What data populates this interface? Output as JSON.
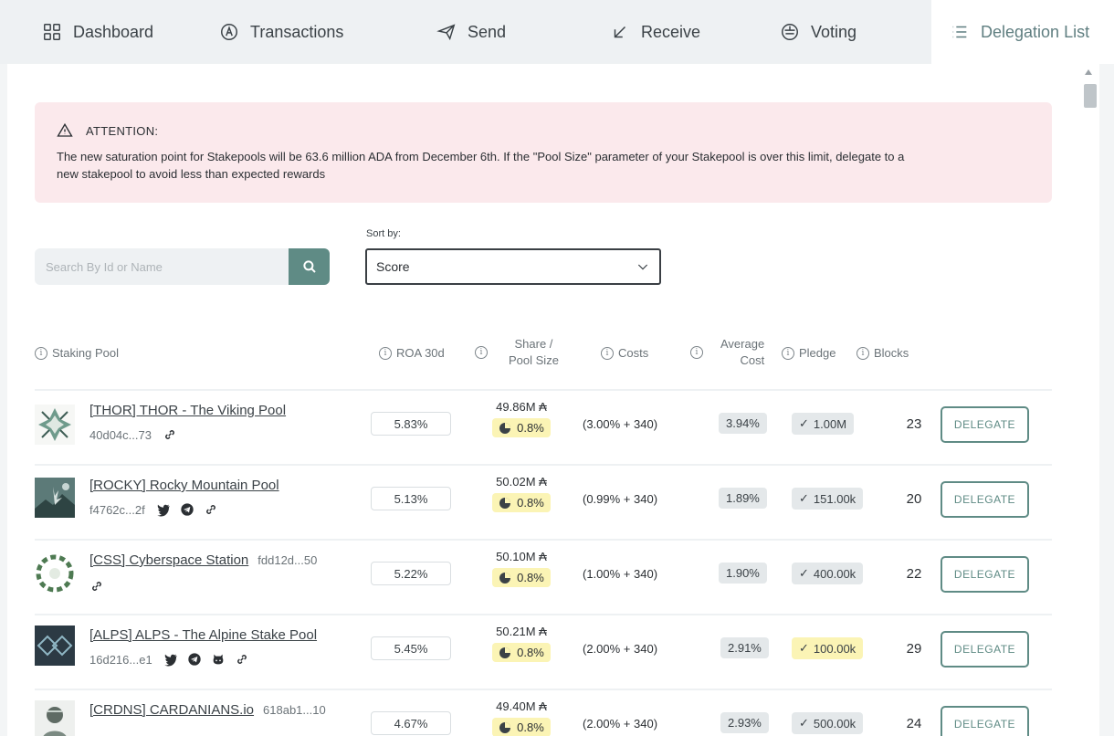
{
  "tabs": [
    {
      "label": "Dashboard",
      "icon": "dashboard-icon"
    },
    {
      "label": "Transactions",
      "icon": "ada-icon"
    },
    {
      "label": "Send",
      "icon": "send-icon"
    },
    {
      "label": "Receive",
      "icon": "receive-arrow-icon"
    },
    {
      "label": "Voting",
      "icon": "voting-icon"
    },
    {
      "label": "Delegation List",
      "icon": "list-icon",
      "active": true
    }
  ],
  "attention": {
    "title": "ATTENTION:",
    "line1": "The new saturation point for Stakepools will be 63.6 million ADA from December 6th. If the \"Pool Size\" parameter of your Stakepool is over this limit, delegate to a",
    "line2": "new stakepool to avoid less than expected rewards"
  },
  "search": {
    "placeholder": "Search By Id or Name"
  },
  "sort": {
    "label": "Sort by:",
    "value": "Score"
  },
  "table": {
    "headers": {
      "pool": "Staking Pool",
      "roa": "ROA 30d",
      "share_1": "Share /",
      "share_2": "Pool Size",
      "costs": "Costs",
      "avg_1": "Average",
      "avg_2": "Cost",
      "pledge": "Pledge",
      "blocks": "Blocks"
    },
    "delegate_label": "DELEGATE",
    "rows": [
      {
        "name": "[THOR] THOR - The Viking Pool",
        "id": "40d04c...73",
        "roa": "5.83%",
        "size": "49.86M ₳",
        "share": "0.8%",
        "costs": "(3.00% + 340)",
        "avg": "3.94%",
        "pledge": "1.00M",
        "blocks": "23"
      },
      {
        "name": "[ROCKY] Rocky Mountain Pool",
        "id": "f4762c...2f",
        "roa": "5.13%",
        "size": "50.02M ₳",
        "share": "0.8%",
        "costs": "(0.99% + 340)",
        "avg": "1.89%",
        "pledge": "151.00k",
        "blocks": "20"
      },
      {
        "name": "[CSS] Cyberspace Station",
        "id": "fdd12d...50",
        "roa": "5.22%",
        "size": "50.10M ₳",
        "share": "0.8%",
        "costs": "(1.00% + 340)",
        "avg": "1.90%",
        "pledge": "400.00k",
        "blocks": "22"
      },
      {
        "name": "[ALPS] ALPS - The Alpine Stake Pool",
        "id": "16d216...e1",
        "roa": "5.45%",
        "size": "50.21M ₳",
        "share": "0.8%",
        "costs": "(2.00% + 340)",
        "avg": "2.91%",
        "pledge": "100.00k",
        "blocks": "29"
      },
      {
        "name": "[CRDNS] CARDANIANS.io",
        "id": "618ab1...10",
        "roa": "4.67%",
        "size": "49.40M ₳",
        "share": "0.8%",
        "costs": "(2.00% + 340)",
        "avg": "2.93%",
        "pledge": "500.00k",
        "blocks": "24"
      }
    ]
  },
  "colors": {
    "accent": "#5f8b85",
    "attention_bg": "#fbe9ec",
    "highlight_yellow": "#fbf4b5",
    "badge_grey": "#e4e8ea"
  }
}
